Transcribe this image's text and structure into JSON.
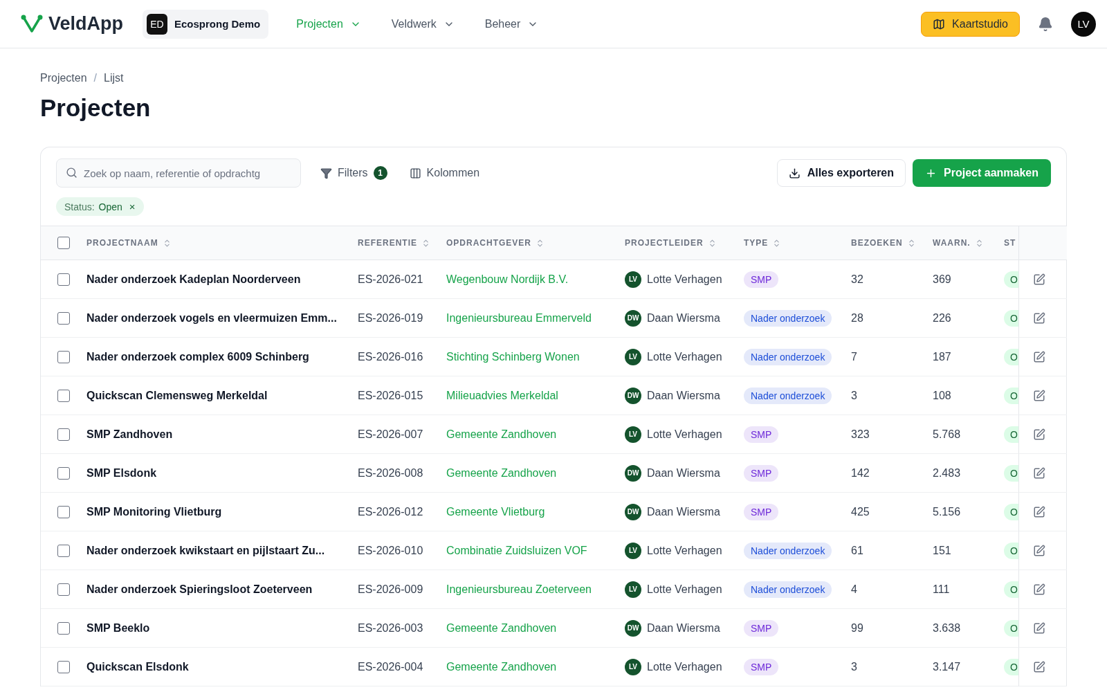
{
  "nav": {
    "logo": "VeldApp",
    "workspace": {
      "initials": "ED",
      "name": "Ecosprong Demo"
    },
    "menu": [
      {
        "label": "Projecten",
        "selected": true
      },
      {
        "label": "Veldwerk",
        "selected": false
      },
      {
        "label": "Beheer",
        "selected": false
      }
    ],
    "map_button": "Kaartstudio",
    "user": "LV"
  },
  "breadcrumb": [
    "Projecten",
    "Lijst"
  ],
  "breadcrumb_separator": "/",
  "title": "Projecten",
  "toolbar": {
    "search": {
      "placeholder": "Zoek op naam, referentie of opdrachtg"
    },
    "filters": "Filters",
    "filter_count": "1",
    "columns": "Kolommen",
    "export": "Alles exporteren",
    "create": "Project aanmaken"
  },
  "active_filter": {
    "label": "Status:",
    "value": "Open",
    "remove": "×"
  },
  "table": {
    "select_all": {
      "checked": false
    },
    "columns": [
      "PROJECTNAAM",
      "REFERENTIE",
      "OPDRACHTGEVER",
      "PROJECTLEIDER",
      "TYPE",
      "BEZOEKEN",
      "WAARN.",
      "ST"
    ],
    "rows": [
      {
        "checked": false,
        "name": "Nader onderzoek Kadeplan Noorderveen",
        "ref": "ES-2026-021",
        "client": "Wegenbouw Nordijk B.V.",
        "leader": {
          "initials": "LV",
          "name": "Lotte Verhagen"
        },
        "type": {
          "label": "SMP",
          "color": "#6d28d9"
        },
        "visits": "32",
        "obs": "369",
        "status": "O"
      },
      {
        "checked": false,
        "name": "Nader onderzoek vogels en vleermuizen Emm...",
        "ref": "ES-2026-019",
        "client": "Ingenieursbureau Emmerveld",
        "leader": {
          "initials": "DW",
          "name": "Daan Wiersma"
        },
        "type": {
          "label": "Nader onderzoek",
          "color": "#1d4ed8"
        },
        "visits": "28",
        "obs": "226",
        "status": "O"
      },
      {
        "checked": false,
        "name": "Nader onderzoek complex 6009 Schinberg",
        "ref": "ES-2026-016",
        "client": "Stichting Schinberg Wonen",
        "leader": {
          "initials": "LV",
          "name": "Lotte Verhagen"
        },
        "type": {
          "label": "Nader onderzoek",
          "color": "#1d4ed8"
        },
        "visits": "7",
        "obs": "187",
        "status": "O"
      },
      {
        "checked": false,
        "name": "Quickscan Clemensweg Merkeldal",
        "ref": "ES-2026-015",
        "client": "Milieuadvies Merkeldal",
        "leader": {
          "initials": "DW",
          "name": "Daan Wiersma"
        },
        "type": {
          "label": "Nader onderzoek",
          "color": "#1d4ed8"
        },
        "visits": "3",
        "obs": "108",
        "status": "O"
      },
      {
        "checked": false,
        "name": "SMP Zandhoven",
        "ref": "ES-2026-007",
        "client": "Gemeente Zandhoven",
        "leader": {
          "initials": "LV",
          "name": "Lotte Verhagen"
        },
        "type": {
          "label": "SMP",
          "color": "#6d28d9"
        },
        "visits": "323",
        "obs": "5.768",
        "status": "O"
      },
      {
        "checked": false,
        "name": "SMP Elsdonk",
        "ref": "ES-2026-008",
        "client": "Gemeente Zandhoven",
        "leader": {
          "initials": "DW",
          "name": "Daan Wiersma"
        },
        "type": {
          "label": "SMP",
          "color": "#6d28d9"
        },
        "visits": "142",
        "obs": "2.483",
        "status": "O"
      },
      {
        "checked": false,
        "name": "SMP Monitoring Vlietburg",
        "ref": "ES-2026-012",
        "client": "Gemeente Vlietburg",
        "leader": {
          "initials": "DW",
          "name": "Daan Wiersma"
        },
        "type": {
          "label": "SMP",
          "color": "#6d28d9"
        },
        "visits": "425",
        "obs": "5.156",
        "status": "O"
      },
      {
        "checked": false,
        "name": "Nader onderzoek kwikstaart en pijlstaart Zu...",
        "ref": "ES-2026-010",
        "client": "Combinatie Zuidsluizen VOF",
        "leader": {
          "initials": "LV",
          "name": "Lotte Verhagen"
        },
        "type": {
          "label": "Nader onderzoek",
          "color": "#1d4ed8"
        },
        "visits": "61",
        "obs": "151",
        "status": "O"
      },
      {
        "checked": false,
        "name": "Nader onderzoek Spieringsloot Zoeterveen",
        "ref": "ES-2026-009",
        "client": "Ingenieursbureau Zoeterveen",
        "leader": {
          "initials": "LV",
          "name": "Lotte Verhagen"
        },
        "type": {
          "label": "Nader onderzoek",
          "color": "#1d4ed8"
        },
        "visits": "4",
        "obs": "111",
        "status": "O"
      },
      {
        "checked": false,
        "name": "SMP Beeklo",
        "ref": "ES-2026-003",
        "client": "Gemeente Zandhoven",
        "leader": {
          "initials": "DW",
          "name": "Daan Wiersma"
        },
        "type": {
          "label": "SMP",
          "color": "#6d28d9"
        },
        "visits": "99",
        "obs": "3.638",
        "status": "O"
      },
      {
        "checked": false,
        "name": "Quickscan Elsdonk",
        "ref": "ES-2026-004",
        "client": "Gemeente Zandhoven",
        "leader": {
          "initials": "LV",
          "name": "Lotte Verhagen"
        },
        "type": {
          "label": "SMP",
          "color": "#6d28d9"
        },
        "visits": "3",
        "obs": "3.147",
        "status": "O"
      }
    ]
  }
}
